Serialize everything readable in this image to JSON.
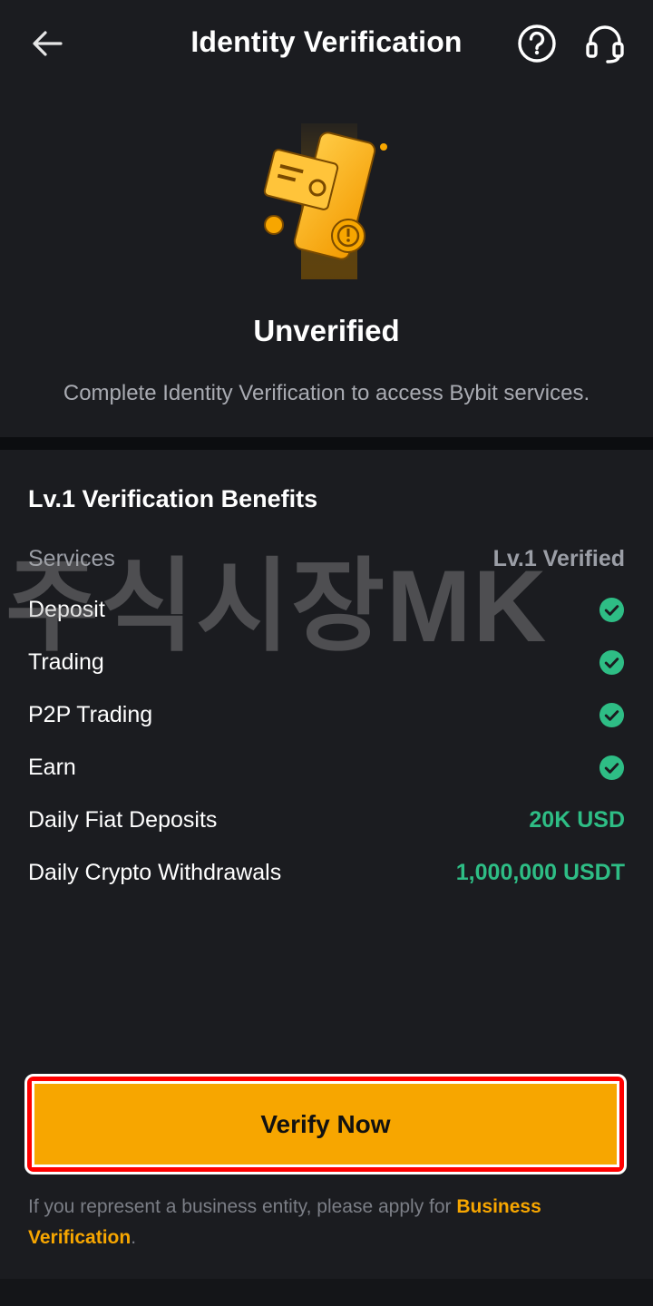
{
  "header": {
    "title": "Identity Verification",
    "back_icon": "arrow-left-icon",
    "help_icon": "question-circle-icon",
    "support_icon": "headset-icon"
  },
  "status": {
    "title": "Unverified",
    "description": "Complete Identity Verification to access Bybit services."
  },
  "benefits": {
    "title": "Lv.1 Verification Benefits",
    "columns": {
      "services": "Services",
      "level": "Lv.1 Verified"
    },
    "rows": [
      {
        "label": "Deposit",
        "value": null,
        "check": true
      },
      {
        "label": "Trading",
        "value": null,
        "check": true
      },
      {
        "label": "P2P Trading",
        "value": null,
        "check": true
      },
      {
        "label": "Earn",
        "value": null,
        "check": true
      },
      {
        "label": "Daily Fiat Deposits",
        "value": "20K USD",
        "check": false
      },
      {
        "label": "Daily Crypto Withdrawals",
        "value": "1,000,000 USDT",
        "check": false
      }
    ]
  },
  "watermark": "주식시장MK",
  "verify_button": {
    "label": "Verify Now"
  },
  "business": {
    "prefix": "If you represent a business entity, please apply for ",
    "link": "Business Verification",
    "suffix": "."
  },
  "colors": {
    "background": "#1b1c20",
    "accent": "#f7a600",
    "success": "#2ebd85",
    "highlight_outline": "#ff0000"
  }
}
